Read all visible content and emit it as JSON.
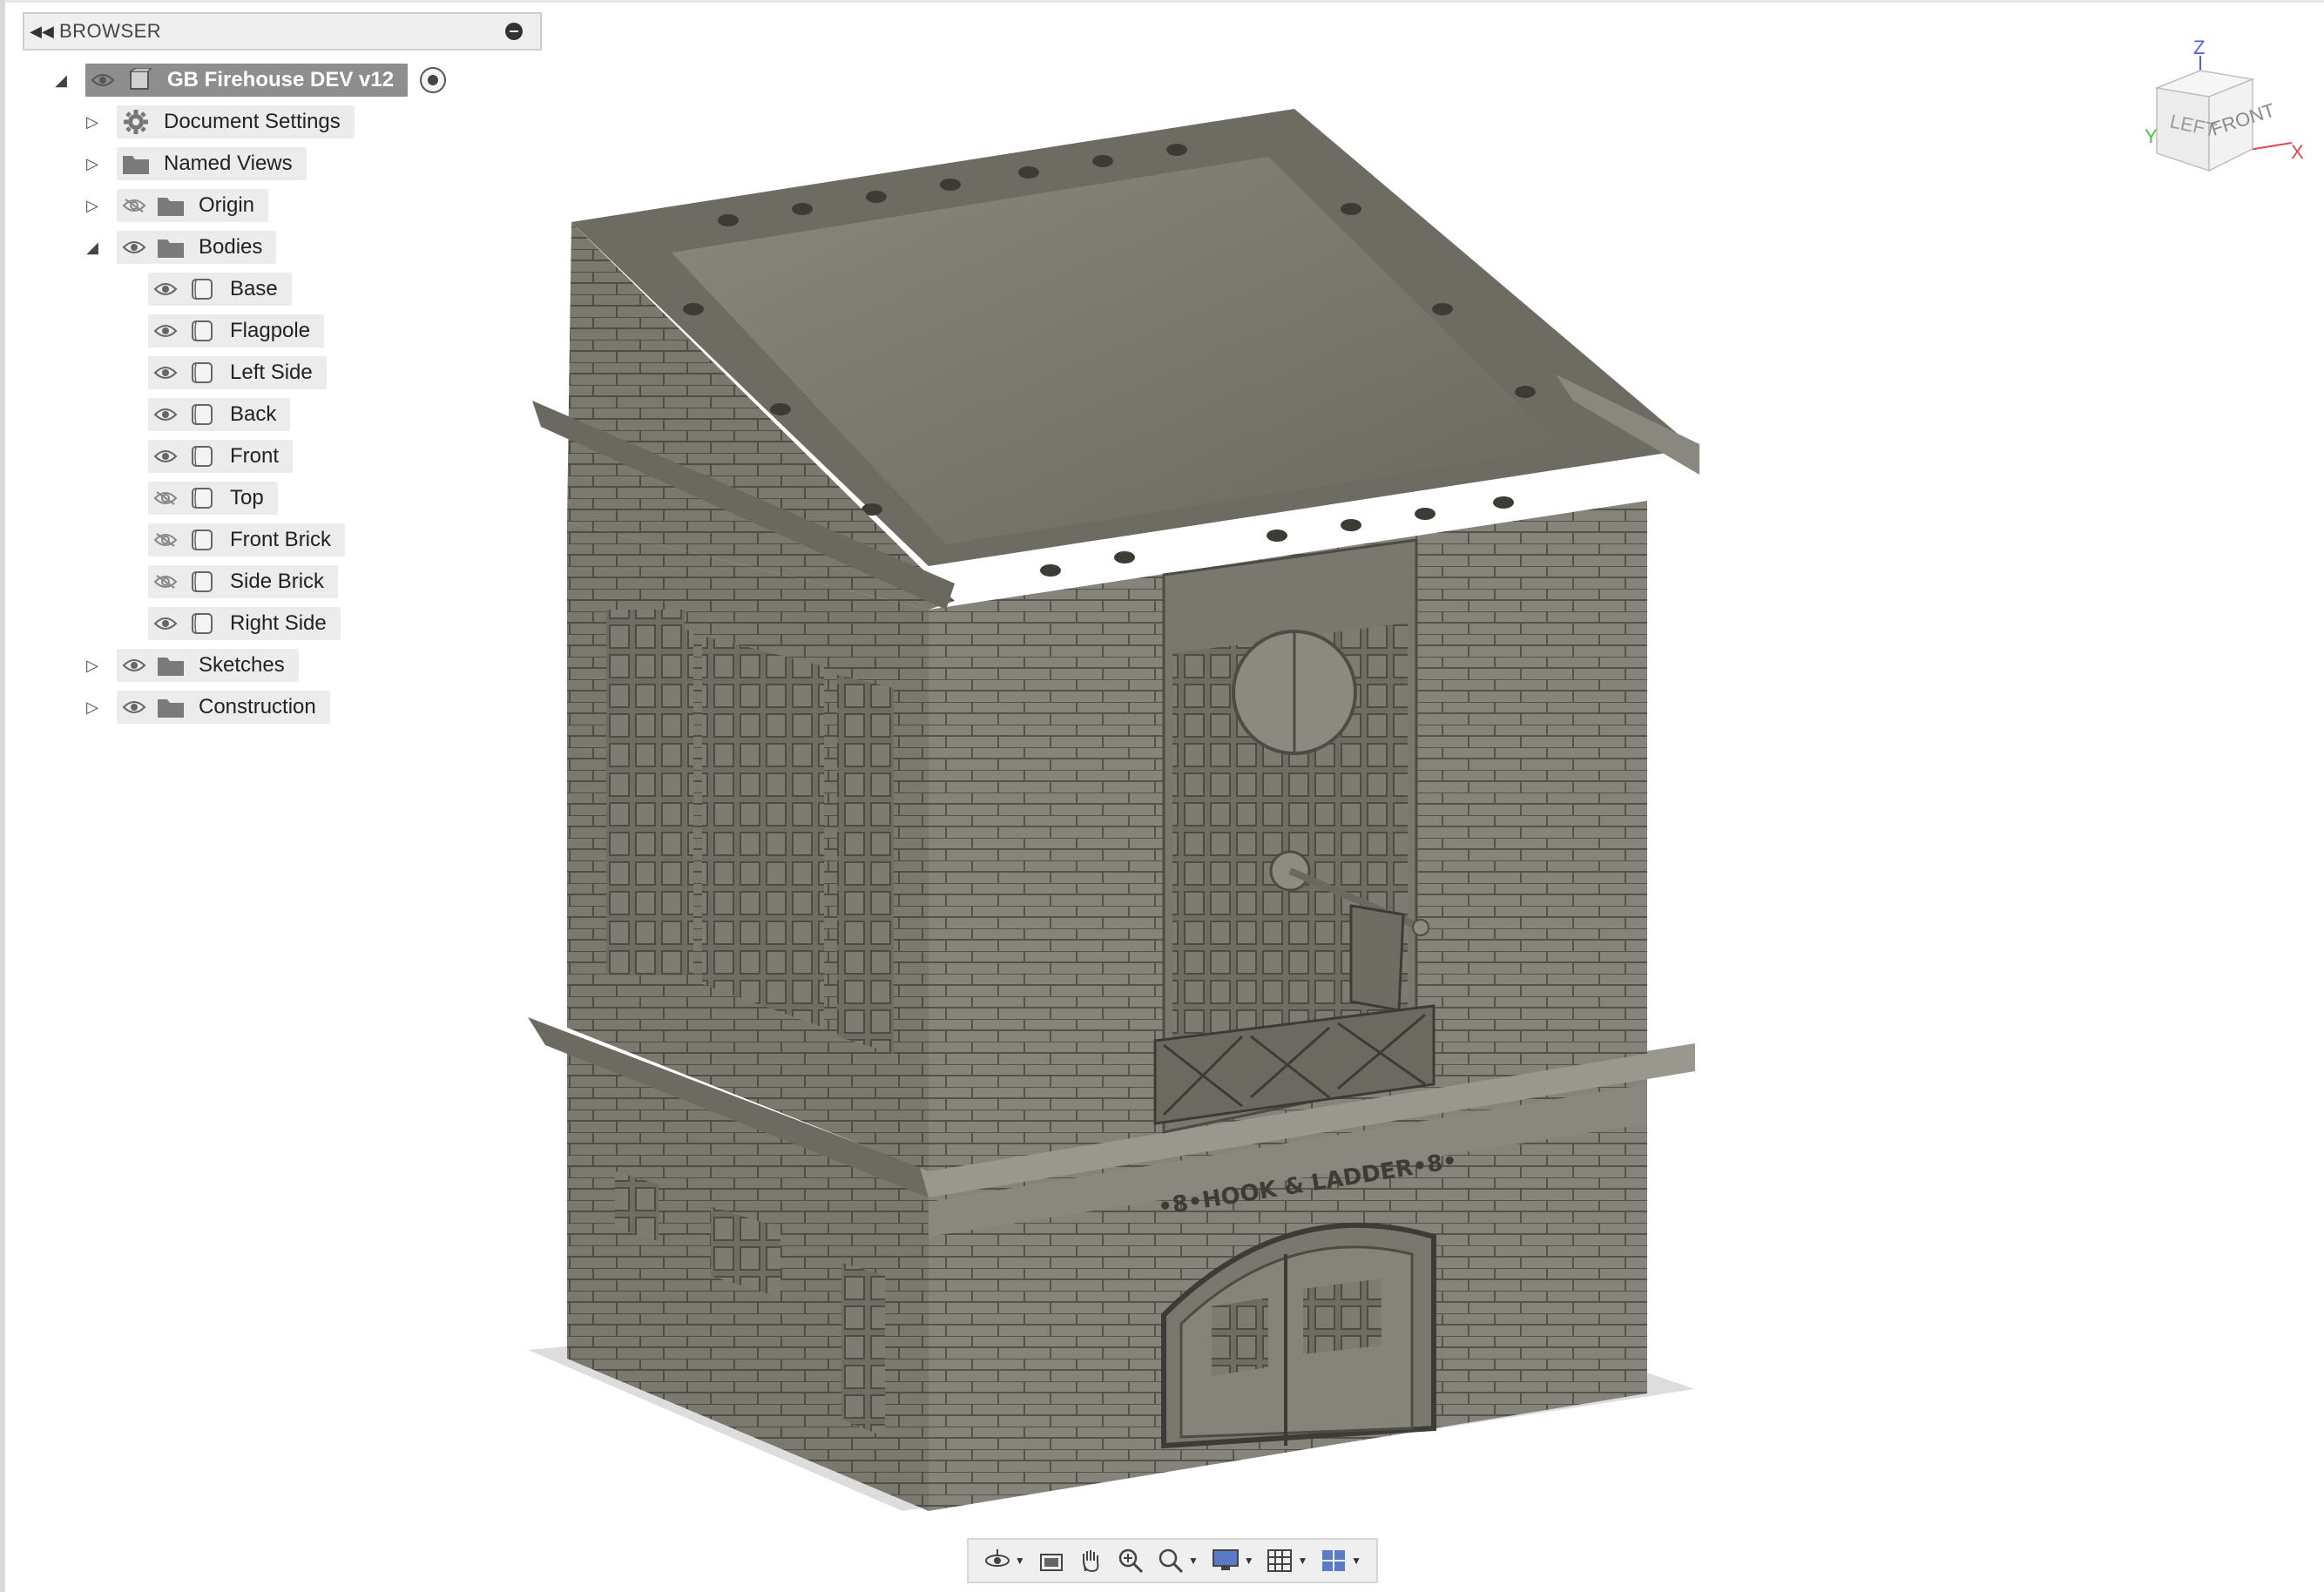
{
  "browser": {
    "title": "BROWSER",
    "collapse_icon": "rewind-icon",
    "root": {
      "label": "GB Firehouse DEV v12"
    },
    "items": [
      {
        "label": "Document Settings",
        "icon": "gear-icon",
        "visible": null,
        "expanded": false
      },
      {
        "label": "Named Views",
        "icon": "folder-icon",
        "visible": null,
        "expanded": false
      },
      {
        "label": "Origin",
        "icon": "folder-icon",
        "visible": false,
        "expanded": false
      },
      {
        "label": "Bodies",
        "icon": "folder-icon",
        "visible": true,
        "expanded": true
      }
    ],
    "bodies": [
      {
        "label": "Base",
        "visible": true
      },
      {
        "label": "Flagpole",
        "visible": true
      },
      {
        "label": "Left Side",
        "visible": true
      },
      {
        "label": "Back",
        "visible": true
      },
      {
        "label": "Front",
        "visible": true
      },
      {
        "label": "Top",
        "visible": false
      },
      {
        "label": "Front Brick",
        "visible": false
      },
      {
        "label": "Side Brick",
        "visible": false
      },
      {
        "label": "Right Side",
        "visible": true
      }
    ],
    "tail_items": [
      {
        "label": "Sketches",
        "visible": true,
        "expanded": false
      },
      {
        "label": "Construction",
        "visible": true,
        "expanded": false
      }
    ]
  },
  "model": {
    "sign_text": "•8•HOOK & LADDER•8•"
  },
  "viewcube": {
    "face_front": "FRONT",
    "face_left": "LEFT",
    "axis_z": "Z",
    "axis_x": "X",
    "axis_y": "Y",
    "colors": {
      "z": "#4a62d8",
      "x": "#e04848",
      "y": "#4ac24a"
    }
  },
  "toolbar": {
    "tools": [
      "orbit-icon",
      "look-at-icon",
      "pan-icon",
      "zoom-icon",
      "fit-icon",
      "display-settings-icon",
      "grid-icon",
      "viewports-icon"
    ]
  },
  "colors": {
    "model_face": "#7d7b70",
    "model_light": "#8e8c81",
    "model_dark": "#5e5c53",
    "model_top": "#6c6a60"
  }
}
